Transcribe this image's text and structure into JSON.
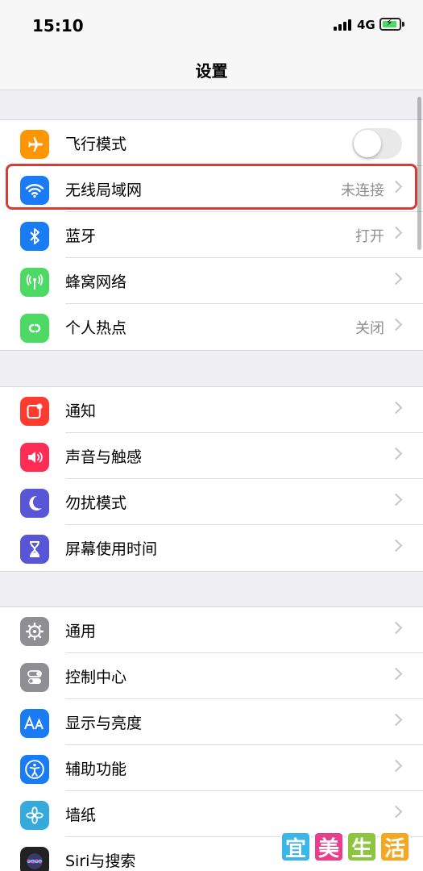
{
  "status": {
    "time": "15:10",
    "network": "4G"
  },
  "nav": {
    "title": "设置"
  },
  "groups": [
    [
      {
        "label": "飞行模式",
        "icon": "airplane-icon",
        "color": "#ff9500",
        "toggle": false
      },
      {
        "label": "无线局域网",
        "value": "未连接",
        "icon": "wifi-icon",
        "color": "#1a7cf5"
      },
      {
        "label": "蓝牙",
        "value": "打开",
        "icon": "bluetooth-icon",
        "color": "#1a7cf5"
      },
      {
        "label": "蜂窝网络",
        "icon": "cellular-icon",
        "color": "#4cd964"
      },
      {
        "label": "个人热点",
        "value": "关闭",
        "icon": "hotspot-icon",
        "color": "#4cd964"
      }
    ],
    [
      {
        "label": "通知",
        "icon": "notifications-icon",
        "color": "#ff3b30"
      },
      {
        "label": "声音与触感",
        "icon": "sound-icon",
        "color": "#ff2d55"
      },
      {
        "label": "勿扰模式",
        "icon": "moon-icon",
        "color": "#5856d6"
      },
      {
        "label": "屏幕使用时间",
        "icon": "hourglass-icon",
        "color": "#5856d6"
      }
    ],
    [
      {
        "label": "通用",
        "icon": "gear-icon",
        "color": "#8e8e93"
      },
      {
        "label": "控制中心",
        "icon": "switches-icon",
        "color": "#8e8e93"
      },
      {
        "label": "显示与亮度",
        "icon": "aa-icon",
        "color": "#1a7cf5"
      },
      {
        "label": "辅助功能",
        "icon": "accessibility-icon",
        "color": "#1a7cf5"
      },
      {
        "label": "墙纸",
        "icon": "flower-icon",
        "color": "#36aadc"
      },
      {
        "label": "Siri与搜索",
        "icon": "siri-icon",
        "color": "#222222"
      }
    ]
  ],
  "watermark": [
    "宜",
    "美",
    "生",
    "活"
  ]
}
